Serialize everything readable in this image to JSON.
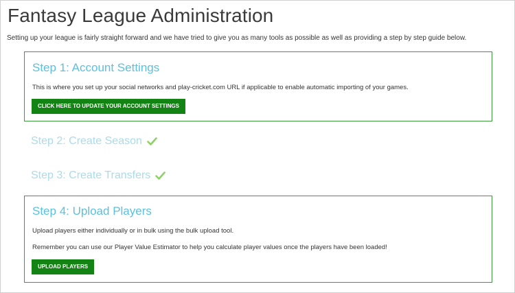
{
  "page": {
    "title": "Fantasy League Administration",
    "intro": "Setting up your league is fairly straight forward and we have tried to give you as many tools as possible as well as providing a step by step guide below."
  },
  "steps": {
    "step1": {
      "title": "Step 1: Account Settings",
      "text": "This is where you set up your social networks and play-cricket.com URL if applicable to enable automatic importing of your games.",
      "button": "CLICK HERE TO UPDATE YOUR ACCOUNT SETTINGS"
    },
    "step2": {
      "title": "Step 2: Create Season",
      "status_icon": "check-icon"
    },
    "step3": {
      "title": "Step 3: Create Transfers",
      "status_icon": "check-icon"
    },
    "step4": {
      "title": "Step 4: Upload Players",
      "text1": "Upload players either individually or in bulk using the bulk upload tool.",
      "text2": "Remember you can use our Player Value Estimator to help you calculate player values once the players have been loaded!",
      "button": "UPLOAD PLAYERS"
    }
  },
  "colors": {
    "step_title": "#5bc0de",
    "completed_title": "#a9dbeb",
    "check": "#8fcf6a",
    "box_border": "#3c9a3c",
    "button_bg": "#138413"
  }
}
